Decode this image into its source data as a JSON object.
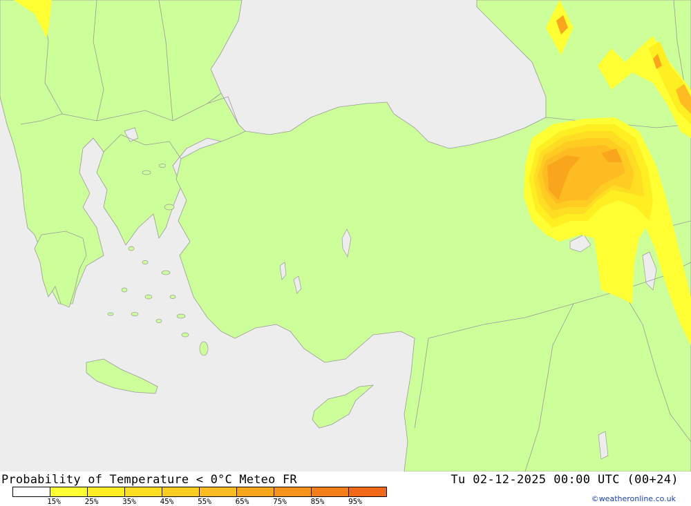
{
  "map": {
    "sea_color": "#ededed",
    "land_color": "#ccff99",
    "border_color": "#999999",
    "probability_colors": {
      "15": "#ffff33",
      "25": "#ffee22",
      "35": "#ffdd22",
      "45": "#ffcc22",
      "55": "#ffbb22",
      "65": "#f9a61c",
      "75": "#f7931c"
    }
  },
  "footer": {
    "title_left": "Probability of Temperature < 0°C Meteo FR",
    "title_right": "Tu 02-12-2025 00:00 UTC (00+24)",
    "credit": "©weatheronline.co.uk",
    "legend": {
      "colors": [
        "#ffffff",
        "#ffff33",
        "#ffee22",
        "#ffdd22",
        "#ffcc22",
        "#ffbb22",
        "#f9a61c",
        "#f7931c",
        "#f47f1a",
        "#f06818"
      ],
      "labels": [
        "15%",
        "25%",
        "35%",
        "45%",
        "55%",
        "65%",
        "75%",
        "85%",
        "95%"
      ]
    }
  }
}
